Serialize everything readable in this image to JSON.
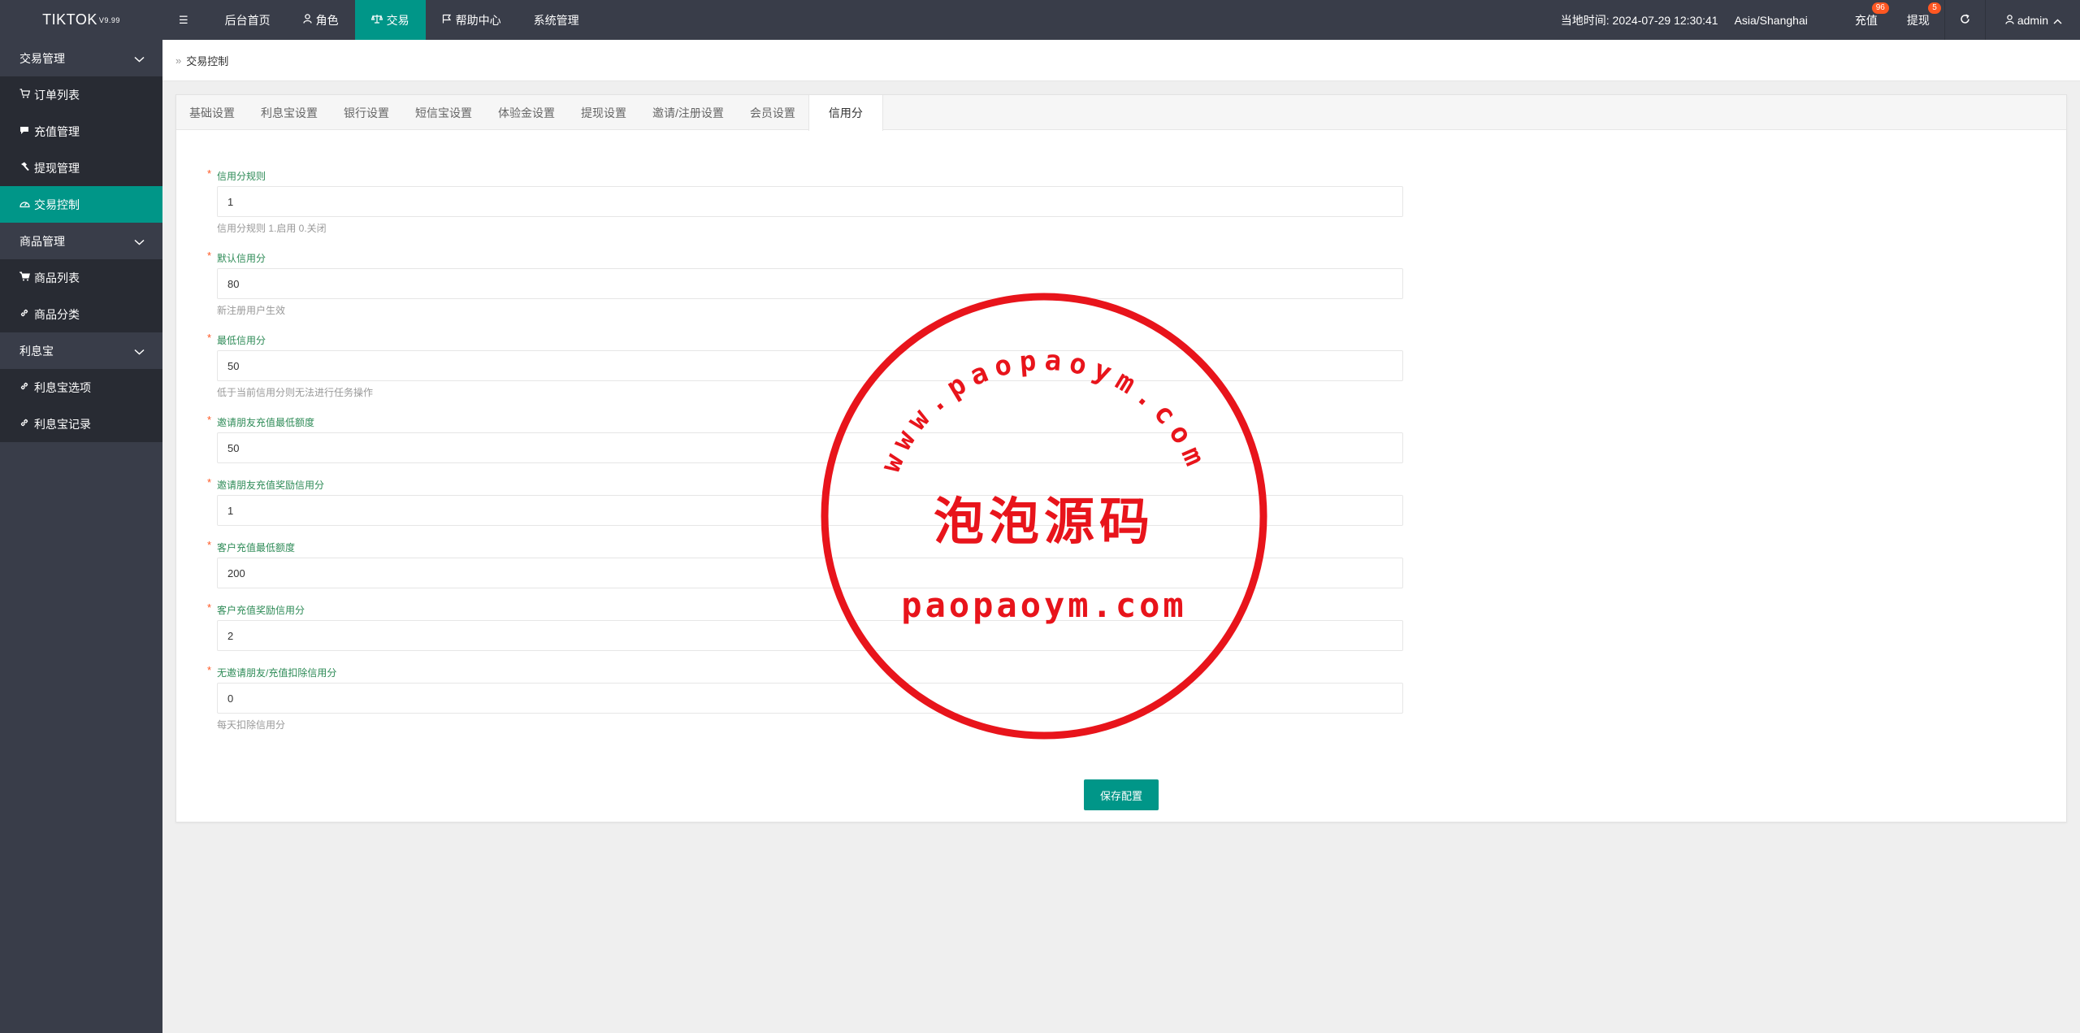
{
  "app": {
    "logo": "TIKTOK",
    "version": "V9.99"
  },
  "topnav": [
    {
      "label": "",
      "icon": "menu-icon"
    },
    {
      "label": "后台首页",
      "icon": ""
    },
    {
      "label": "角色",
      "icon": "user-icon"
    },
    {
      "label": "交易",
      "icon": "scale-icon",
      "active": true
    },
    {
      "label": "帮助中心",
      "icon": "flag-icon"
    },
    {
      "label": "系统管理",
      "icon": ""
    }
  ],
  "header_right": {
    "time_label": "当地时间: 2024-07-29 12:30:41",
    "timezone": "Asia/Shanghai",
    "recharge_label": "充值",
    "recharge_count": "96",
    "withdraw_label": "提现",
    "withdraw_count": "5",
    "user": "admin"
  },
  "sidebar": {
    "groups": [
      {
        "label": "交易管理",
        "items": [
          {
            "label": "订单列表",
            "icon": "cart-icon"
          },
          {
            "label": "充值管理",
            "icon": "comment-icon"
          },
          {
            "label": "提现管理",
            "icon": "hammer-icon"
          },
          {
            "label": "交易控制",
            "icon": "dashboard-icon",
            "active": true
          }
        ]
      },
      {
        "label": "商品管理",
        "items": [
          {
            "label": "商品列表",
            "icon": "cart-icon"
          },
          {
            "label": "商品分类",
            "icon": "link-icon"
          }
        ]
      },
      {
        "label": "利息宝",
        "items": [
          {
            "label": "利息宝选项",
            "icon": "link-icon"
          },
          {
            "label": "利息宝记录",
            "icon": "link-icon"
          }
        ]
      }
    ]
  },
  "breadcrumb": "交易控制",
  "tabs": [
    "基础设置",
    "利息宝设置",
    "银行设置",
    "短信宝设置",
    "体验金设置",
    "提现设置",
    "邀请/注册设置",
    "会员设置",
    "信用分"
  ],
  "active_tab": "信用分",
  "fields": [
    {
      "label": "信用分规则",
      "value": "1",
      "hint": "信用分规则 1.启用 0.关闭"
    },
    {
      "label": "默认信用分",
      "value": "80",
      "hint": "新注册用户生效"
    },
    {
      "label": "最低信用分",
      "value": "50",
      "hint": "低于当前信用分则无法进行任务操作"
    },
    {
      "label": "邀请朋友充值最低额度",
      "value": "50",
      "hint": ""
    },
    {
      "label": "邀请朋友充值奖励信用分",
      "value": "1",
      "hint": ""
    },
    {
      "label": "客户充值最低额度",
      "value": "200",
      "hint": ""
    },
    {
      "label": "客户充值奖励信用分",
      "value": "2",
      "hint": ""
    },
    {
      "label": "无邀请朋友/充值扣除信用分",
      "value": "0",
      "hint": "每天扣除信用分"
    }
  ],
  "save_label": "保存配置",
  "watermark": {
    "top_arc": "www.paopaoym.com",
    "center": "泡泡源码",
    "bottom": "paopaoym.com",
    "color": "#e8141b"
  },
  "colors": {
    "accent": "#009688",
    "header_bg": "#393d49",
    "badge": "#ff5722",
    "label_green": "#2e8b57"
  }
}
